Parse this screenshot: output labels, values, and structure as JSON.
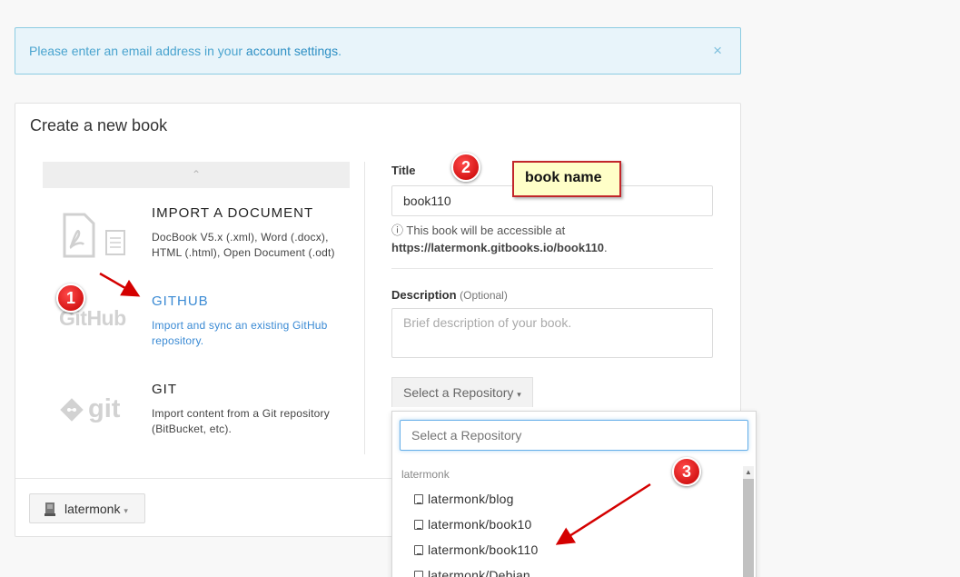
{
  "alert": {
    "text": "Please enter an email address in your ",
    "link": "account settings",
    "suffix": ".",
    "close": "×"
  },
  "panel": {
    "title": "Create a new book"
  },
  "import_list": {
    "scroll_up": "⌃",
    "items": [
      {
        "title": "IMPORT A DOCUMENT",
        "desc": "DocBook V5.x (.xml), Word (.docx), HTML (.html), Open Document (.odt)"
      },
      {
        "title": "GITHUB",
        "desc": "Import and sync an existing GitHub repository.",
        "logo": "GitHub"
      },
      {
        "title": "GIT",
        "desc": "Import content from a Git repository (BitBucket, etc).",
        "logo": "git"
      }
    ]
  },
  "form": {
    "title_label": "Title",
    "title_value": "book110",
    "help_prefix": "This book will be accessible at",
    "help_url": "https://latermonk.gitbooks.io/book110",
    "help_suffix": ".",
    "desc_label": "Description",
    "desc_optional": "(Optional)",
    "desc_placeholder": "Brief description of your book.",
    "repo_button": "Select a Repository"
  },
  "footer": {
    "user": "latermonk"
  },
  "dropdown": {
    "search_placeholder": "Select a Repository",
    "group": "latermonk",
    "repos": [
      "latermonk/blog",
      "latermonk/book10",
      "latermonk/book110",
      "latermonk/Debian"
    ]
  },
  "annotations": {
    "badge1": "1",
    "badge2": "2",
    "badge3": "3",
    "note": "book name"
  },
  "colors": {
    "accent": "#3a8ad4",
    "alert_bg": "#e8f4fa",
    "badge": "#d40000"
  }
}
